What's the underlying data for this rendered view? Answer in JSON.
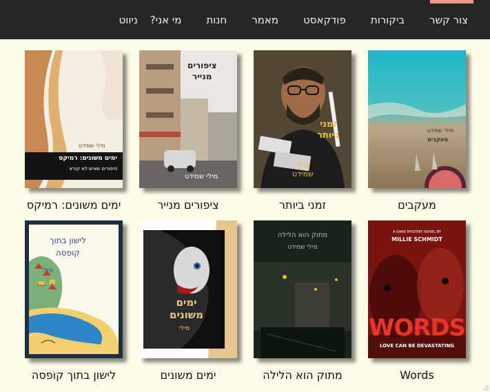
{
  "nav": {
    "items": [
      "ניווט",
      "מי אני?",
      "חנות",
      "מאמר",
      "פודקאסט",
      "ביקורות",
      "צור קשר"
    ]
  },
  "colors": {
    "nav_bg": "#262626",
    "nav_text": "#f4f4f4",
    "nav_accent": "#f4988a",
    "page_bg": "#fdfce8"
  },
  "books": [
    {
      "title": "מעקבים",
      "cover_text": [
        "מילי שמידט",
        "מעקבים"
      ]
    },
    {
      "title": "זמני ביותר",
      "cover_text": [
        "זמני",
        "ביותר",
        "מילי",
        "שמידט"
      ]
    },
    {
      "title": "ציפורים מנייר",
      "cover_text": [
        "ציפורים",
        "מנייר",
        "מילי שמידט"
      ]
    },
    {
      "title": "ימים משונים: רמיקס",
      "cover_text": [
        "מילי שמידט",
        "ימים משונים: רמיקס",
        "סיפורים שאיש לא קורא"
      ]
    },
    {
      "title": "Words",
      "cover_text": [
        "A DARK MYSTERY NOVEL BY",
        "MILLIE SCHMIDT",
        "WORDS",
        "LOVE CAN BE DEVASTATING"
      ]
    },
    {
      "title": "מתוק הוא הלילה",
      "cover_text": [
        "מתוק הוא הלילה",
        "מילי שמידט"
      ]
    },
    {
      "title": "ימים משונים",
      "cover_text": [
        "ימים",
        "משונים",
        "מילי"
      ]
    },
    {
      "title": "לישון בתוך קופסה",
      "cover_text": [
        "לישון בתוך",
        "קופסה",
        "מילי"
      ]
    }
  ]
}
